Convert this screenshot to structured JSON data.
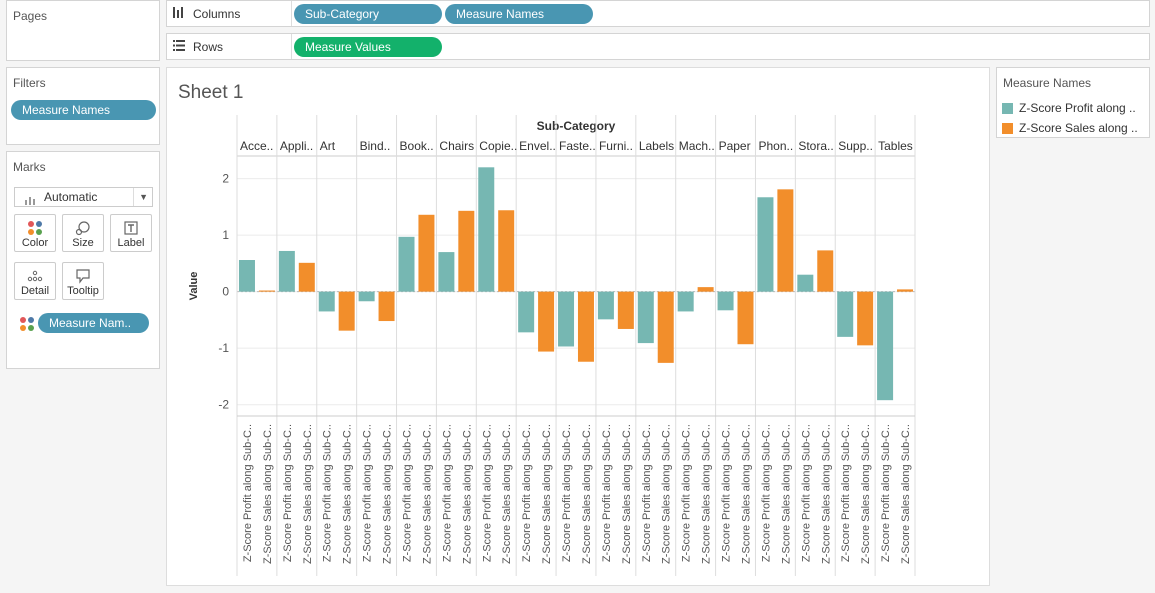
{
  "pages": {
    "title": "Pages"
  },
  "columns": {
    "label": "Columns",
    "pills": [
      "Sub-Category",
      "Measure Names"
    ]
  },
  "rows": {
    "label": "Rows",
    "pills": [
      "Measure Values"
    ]
  },
  "filters": {
    "title": "Filters",
    "pills": [
      "Measure Names"
    ]
  },
  "marks": {
    "title": "Marks",
    "type_value": "Automatic",
    "buttons": {
      "color": "Color",
      "size": "Size",
      "label": "Label",
      "detail": "Detail",
      "tooltip": "Tooltip"
    },
    "field_pill": "Measure Nam.."
  },
  "sheet": {
    "title": "Sheet 1"
  },
  "legend": {
    "title": "Measure Names",
    "items": [
      {
        "label": "Z-Score Profit along ..",
        "color": "#76b7b2"
      },
      {
        "label": "Z-Score Sales along ..",
        "color": "#f28e2b"
      }
    ]
  },
  "chart_data": {
    "type": "bar",
    "header_title": "Sub-Category",
    "ylabel": "Value",
    "ylim": [
      -2.2,
      2.4
    ],
    "yticks": [
      2,
      1,
      0,
      -1,
      -2
    ],
    "grid": true,
    "category_labels": [
      "Acce..",
      "Appli..",
      "Art",
      "Bind..",
      "Book..",
      "Chairs",
      "Copie..",
      "Envel..",
      "Faste..",
      "Furni..",
      "Labels",
      "Mach..",
      "Paper",
      "Phon..",
      "Stora..",
      "Supp..",
      "Tables"
    ],
    "measure_axis_labels": [
      "Z-Score Profit along Sub-C..",
      "Z-Score Sales along Sub-C.."
    ],
    "series": [
      {
        "color": "#76b7b2",
        "values": [
          0.56,
          0.72,
          -0.35,
          -0.17,
          0.97,
          0.7,
          2.2,
          -0.72,
          -0.97,
          -0.49,
          -0.91,
          -0.35,
          -0.33,
          1.67,
          0.3,
          -0.8,
          -1.92
        ]
      },
      {
        "color": "#f28e2b",
        "values": [
          0.02,
          0.51,
          -0.69,
          -0.52,
          1.36,
          1.43,
          1.44,
          -1.06,
          -1.24,
          -0.66,
          -1.26,
          0.08,
          -0.93,
          1.81,
          0.73,
          -0.95,
          0.04
        ]
      }
    ]
  }
}
